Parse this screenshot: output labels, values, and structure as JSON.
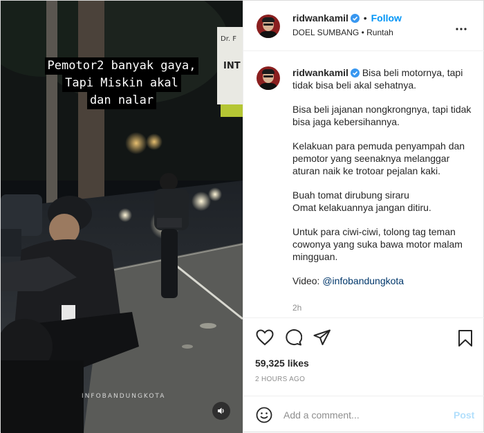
{
  "post": {
    "username": "ridwankamil",
    "follow_label": "Follow",
    "song_artist": "DOEL SUMBANG",
    "song_title": "Runtah",
    "more_icon": "more-dots-icon"
  },
  "media": {
    "overlay_lines": [
      "Pemotor2 banyak gaya,",
      "Tapi Miskin akal",
      "dan nalar"
    ],
    "watermark": "INFOBANDUNGKOTA",
    "sign_text_1": "Dr. F",
    "sign_text_2": "INT",
    "sound_icon": "speaker-icon"
  },
  "caption": {
    "username": "ridwankamil",
    "first_text": "Bisa beli motornya, tapi tidak bisa beli akal sehatnya.",
    "p2": "Bisa beli jajanan nongkrongnya, tapi tidak bisa jaga kebersihannya.",
    "p3": "Kelakuan para pemuda penyampah dan pemotor yang seenaknya melanggar aturan naik ke trotoar pejalan kaki.",
    "p4_line1": "Buah tomat dirubung siraru",
    "p4_line2": "Omat kelakuannya jangan ditiru.",
    "p5": "Untuk para ciwi-ciwi, tolong tag teman cowonya yang suka bawa motor malam mingguan.",
    "video_label": "Video:",
    "video_link": "@infobandungkota",
    "time": "2h"
  },
  "actions": {
    "like_icon": "heart-icon",
    "comment_icon": "comment-icon",
    "share_icon": "share-icon",
    "save_icon": "bookmark-icon",
    "likes_text": "59,325 likes",
    "posted_ago": "2 HOURS AGO"
  },
  "composer": {
    "placeholder": "Add a comment...",
    "post_label": "Post",
    "emoji_icon": "smiley-icon"
  },
  "colors": {
    "follow": "#0095f6",
    "link": "#00376b",
    "post_disabled": "#b2dffc",
    "verified": "#3897f0"
  }
}
